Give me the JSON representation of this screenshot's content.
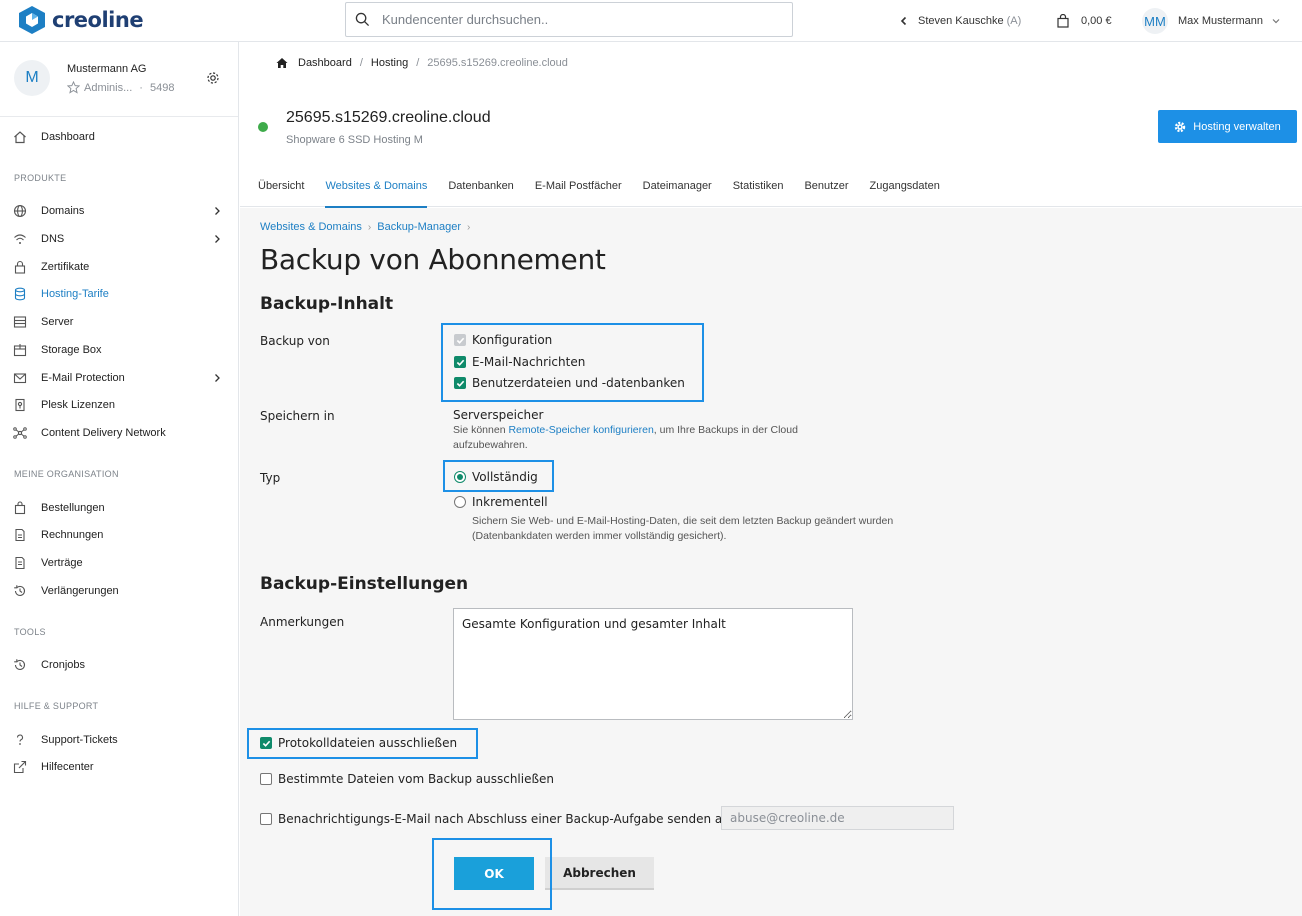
{
  "brand": {
    "name": "creoline"
  },
  "search": {
    "placeholder": "Kundencenter durchsuchen.."
  },
  "topbar": {
    "impersonation_name": "Steven Kauschke",
    "impersonation_suffix": "(A)",
    "cart_amount": "0,00 €",
    "user_initials": "MM",
    "user_name": "Max Mustermann"
  },
  "org": {
    "initial": "M",
    "name": "Mustermann AG",
    "role": "Adminis...",
    "separator": "·",
    "id": "5498"
  },
  "sidebar": {
    "dashboard": "Dashboard",
    "section_products": "PRODUKTE",
    "products": [
      {
        "label": "Domains",
        "icon": "globe-icon",
        "chevron": true
      },
      {
        "label": "DNS",
        "icon": "wifi-icon",
        "chevron": true
      },
      {
        "label": "Zertifikate",
        "icon": "lock-icon",
        "chevron": false
      },
      {
        "label": "Hosting-Tarife",
        "icon": "database-icon",
        "chevron": false,
        "active": true
      },
      {
        "label": "Server",
        "icon": "server-icon",
        "chevron": false
      },
      {
        "label": "Storage Box",
        "icon": "box-icon",
        "chevron": false
      },
      {
        "label": "E-Mail Protection",
        "icon": "envelope-icon",
        "chevron": true
      },
      {
        "label": "Plesk Lizenzen",
        "icon": "key-icon",
        "chevron": false
      },
      {
        "label": "Content Delivery Network",
        "icon": "network-icon",
        "chevron": false
      }
    ],
    "section_org": "MEINE ORGANISATION",
    "org_items": [
      {
        "label": "Bestellungen",
        "icon": "bag-icon"
      },
      {
        "label": "Rechnungen",
        "icon": "invoice-icon"
      },
      {
        "label": "Verträge",
        "icon": "contract-icon"
      },
      {
        "label": "Verlängerungen",
        "icon": "history-icon"
      }
    ],
    "section_tools": "TOOLS",
    "tools_items": [
      {
        "label": "Cronjobs",
        "icon": "history-icon"
      }
    ],
    "section_help": "HILFE & SUPPORT",
    "help_items": [
      {
        "label": "Support-Tickets",
        "icon": "ticket-icon"
      },
      {
        "label": "Hilfecenter",
        "icon": "external-link-icon"
      }
    ]
  },
  "breadcrumb": {
    "home": "Dashboard",
    "sep": "/",
    "hosting": "Hosting",
    "current": "25695.s15269.creoline.cloud"
  },
  "host": {
    "title": "25695.s15269.creoline.cloud",
    "subtitle": "Shopware 6 SSD Hosting M",
    "status_color": "#3eab4a"
  },
  "manage_button": "Hosting verwalten",
  "tabs": [
    {
      "label": "Übersicht"
    },
    {
      "label": "Websites & Domains",
      "active": true
    },
    {
      "label": "Datenbanken"
    },
    {
      "label": "E-Mail Postfächer"
    },
    {
      "label": "Dateimanager"
    },
    {
      "label": "Statistiken"
    },
    {
      "label": "Benutzer"
    },
    {
      "label": "Zugangsdaten"
    }
  ],
  "plesk": {
    "crumb1": "Websites & Domains",
    "crumb2": "Backup-Manager",
    "title": "Backup von Abonnement",
    "section1": "Backup-Inhalt",
    "backup_of_label": "Backup von",
    "backup_options": [
      {
        "label": "Konfiguration",
        "checked": true,
        "disabled": true
      },
      {
        "label": "E-Mail-Nachrichten",
        "checked": true
      },
      {
        "label": "Benutzerdateien und -datenbanken",
        "checked": true
      }
    ],
    "store_label": "Speichern in",
    "store_value": "Serverspeicher",
    "store_hint_pre": "Sie können ",
    "store_hint_link": "Remote-Speicher konfigurieren",
    "store_hint_post": ", um Ihre Backups in der Cloud",
    "store_hint_line2": "aufzubewahren.",
    "type_label": "Typ",
    "type_full": "Vollständig",
    "type_incremental": "Inkrementell",
    "type_hint_line1": "Sichern Sie Web- und E-Mail-Hosting-Daten, die seit dem letzten Backup geändert wurden",
    "type_hint_line2": "(Datenbankdaten werden immer vollständig gesichert).",
    "selected_type": "Vollständig",
    "section2": "Backup-Einstellungen",
    "notes_label": "Anmerkungen",
    "notes_value": "Gesamte Konfiguration und gesamter Inhalt",
    "exclude_logs": "Protokolldateien ausschließen",
    "exclude_logs_checked": true,
    "exclude_files": "Bestimmte Dateien vom Backup ausschließen",
    "exclude_files_checked": false,
    "notify_label": "Benachrichtigungs-E-Mail nach Abschluss einer Backup-Aufgabe senden an",
    "notify_checked": false,
    "notify_email": "abuse@creoline.de",
    "ok": "OK",
    "cancel": "Abbrechen"
  },
  "colors": {
    "accent": "#1d7fc4",
    "checkbox": "#0f8a6a",
    "highlight": "#1d90e6"
  }
}
